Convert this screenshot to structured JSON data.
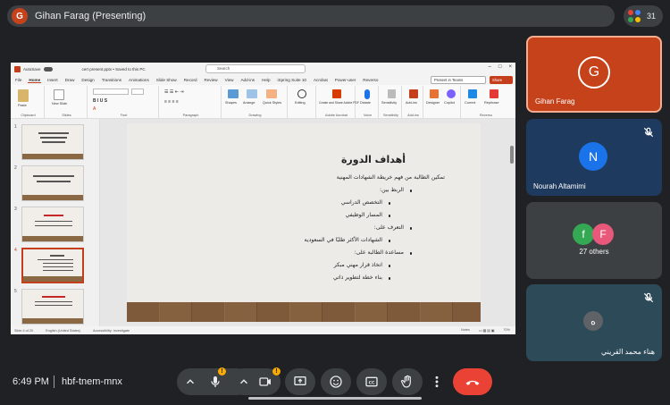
{
  "presenter": {
    "avatar_letter": "G",
    "label": "Gihan Farag (Presenting)"
  },
  "people": {
    "count": "31"
  },
  "ppt": {
    "autosave": "AutoSave",
    "file_title": "cert present.pptx • Saved to this PC",
    "search_placeholder": "Search",
    "menu_tabs": [
      "File",
      "Home",
      "Insert",
      "Draw",
      "Design",
      "Transitions",
      "Animations",
      "Slide Show",
      "Record",
      "Review",
      "View",
      "Add-ins",
      "Help",
      "iSpring Suite 10",
      "Acrobat",
      "Power-user",
      "Reverso"
    ],
    "present_teams": "Present in Teams",
    "share": "Share",
    "ribbon_groups": [
      "Clipboard",
      "Slides",
      "Font",
      "Paragraph",
      "Drawing",
      "Adobe Acrobat",
      "Voice",
      "Sensitivity",
      "Add-ins",
      "Reverso"
    ],
    "ribbon_labels": {
      "paste": "Paste",
      "new_slide": "New Slide",
      "shapes": "Shapes",
      "arrange": "Arrange",
      "quick_styles": "Quick Styles",
      "editing": "Editing",
      "create_pdf": "Create and Share Adobe PDF",
      "dictate": "Dictate",
      "sensitivity": "Sensitivity",
      "add_ins": "Add-ins",
      "designer": "Designer",
      "copilot": "Copilot",
      "correct": "Correct",
      "rephrase": "Rephrase"
    },
    "slide_numbers": [
      "1",
      "2",
      "3",
      "4",
      "5"
    ],
    "status": {
      "slide_of": "Slide 4 of 20",
      "language": "English (United States)",
      "accessibility": "Accessibility: Investigate",
      "notes": "Notes",
      "zoom": "70%"
    }
  },
  "slide": {
    "title": "أهداف الدورة",
    "lines": [
      "تمكين الطالبة من فهم خريطة الشهادات المهنية",
      "الربط بين:",
      "التخصص الدراسي",
      "المسار الوظيفي",
      "التعرف على:",
      "الشهادات الأكثر طلبًا في السعودية",
      "مساعدة الطالبة على:",
      "اتخاذ قرار مهني مبكر",
      "بناء خطة لتطوير ذاتي"
    ]
  },
  "participants": [
    {
      "letter": "G",
      "name": "Gihan Farag",
      "color": "#c5421b"
    },
    {
      "letter": "N",
      "name": "Nourah Altamimi",
      "color": "#1a73e8"
    },
    {
      "letters": [
        "f",
        "F"
      ],
      "name": "27 others",
      "colors": [
        "#34a853",
        "#e8587a"
      ]
    },
    {
      "letter": "ه",
      "name": "هناء محمد القريني",
      "color": "#5f6368"
    }
  ],
  "meeting": {
    "time": "6:49 PM",
    "code": "hbf-tnem-mnx"
  },
  "colors": {
    "end_call": "#ea4335",
    "warning": "#f9ab00",
    "control_bg": "#3c4043"
  }
}
